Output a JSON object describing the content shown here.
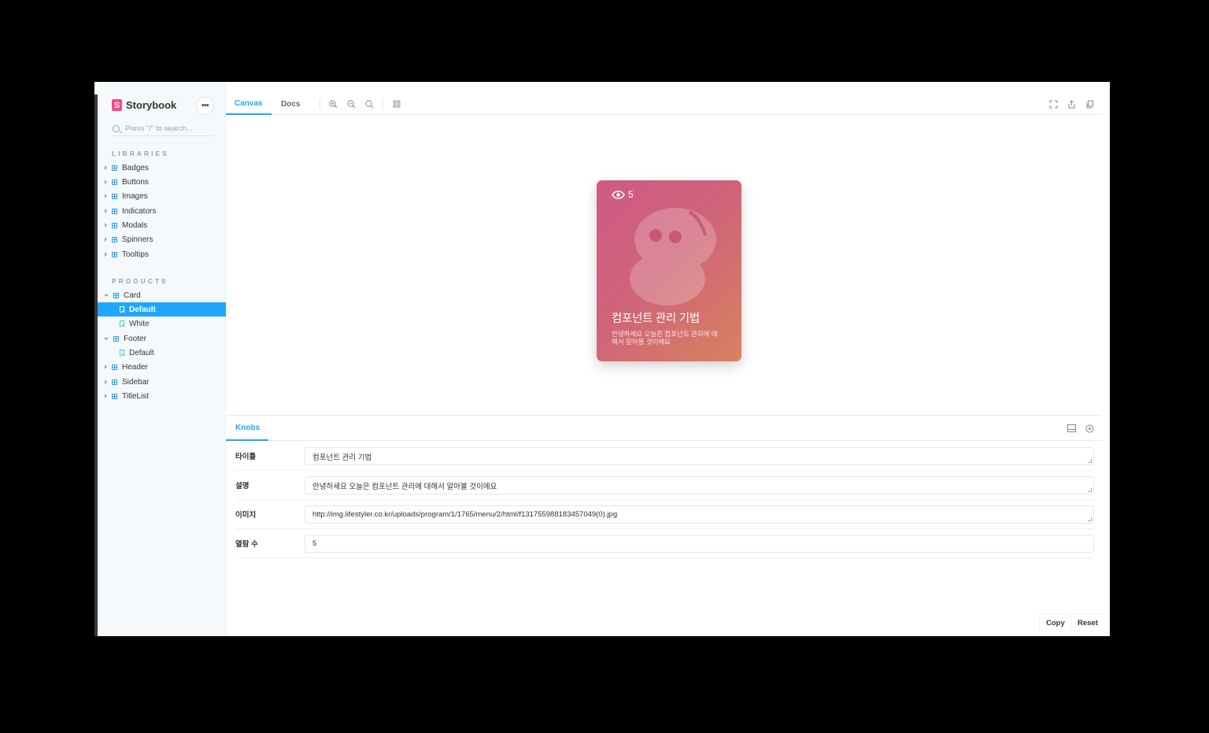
{
  "app": {
    "brand": "Storybook",
    "brand_glyph": "S",
    "menu_dots": "•••"
  },
  "sidebar": {
    "search_placeholder": "Press \"/\" to search...",
    "libraries_title": "LIBRARIES",
    "libraries": [
      "Badges",
      "Buttons",
      "Images",
      "Indicators",
      "Modals",
      "Spinners",
      "Tooltips"
    ],
    "products_title": "PRODUCTS",
    "products": {
      "card": "Card",
      "card_default": "Default",
      "card_white": "White",
      "footer": "Footer",
      "footer_default": "Default",
      "header": "Header",
      "sidebar": "Sidebar",
      "titlelist": "TitleList"
    }
  },
  "toolbar": {
    "tab_canvas": "Canvas",
    "tab_docs": "Docs",
    "icons": [
      "zoom-in-icon",
      "zoom-out-icon",
      "zoom-reset-icon",
      "grid-icon",
      "fullscreen-icon",
      "share-icon",
      "copy-icon"
    ]
  },
  "card": {
    "views": "5",
    "title": "컴포넌트 관리 기법",
    "desc": "안녕하세요 오늘은 컴포넌트 관리에 대해서 알아볼 것이에요",
    "gradient": [
      "#cf5a86",
      "#d8825f"
    ]
  },
  "panel": {
    "tab": "Knobs",
    "knobs": [
      {
        "label": "타이틀",
        "value": "컴포넌트 관리 기법"
      },
      {
        "label": "설명",
        "value": "안녕하세요 오늘은 컴포넌트 관리에 대해서 알아볼 것이에요"
      },
      {
        "label": "이미지",
        "value": "http://img.lifestyler.co.kr/uploads/program/1/1765/menu/2/html/f131755988183457049(0).jpg"
      },
      {
        "label": "열람 수",
        "value": "5"
      }
    ],
    "copy_label": "Copy",
    "reset_label": "Reset"
  },
  "colors": {
    "accent": "#1ea7fd",
    "brand": "#ff4785"
  }
}
